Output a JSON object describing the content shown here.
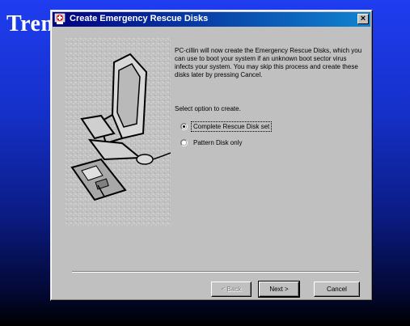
{
  "background": {
    "title": "Tren"
  },
  "dialog": {
    "title": "Create Emergency Rescue Disks",
    "close_glyph": "×",
    "description": "PC-cillin will now create the Emergency Rescue Disks, which you can use to boot your system if an unknown boot sector virus infects your system. You may skip this process and create these disks later by pressing Cancel.",
    "prompt": "Select option to create.",
    "options": [
      {
        "label": "Complete Rescue Disk set",
        "selected": true
      },
      {
        "label": "Pattern Disk only",
        "selected": false
      }
    ],
    "buttons": {
      "back": "< Back",
      "next": "Next >",
      "cancel": "Cancel"
    }
  },
  "colors": {
    "titlebar_start": "#000080",
    "titlebar_end": "#1084d0",
    "face": "#c0c0c0",
    "background_blue": "#1f3df0"
  },
  "icons": [
    "app-icon",
    "close-icon",
    "computer-illustration"
  ]
}
